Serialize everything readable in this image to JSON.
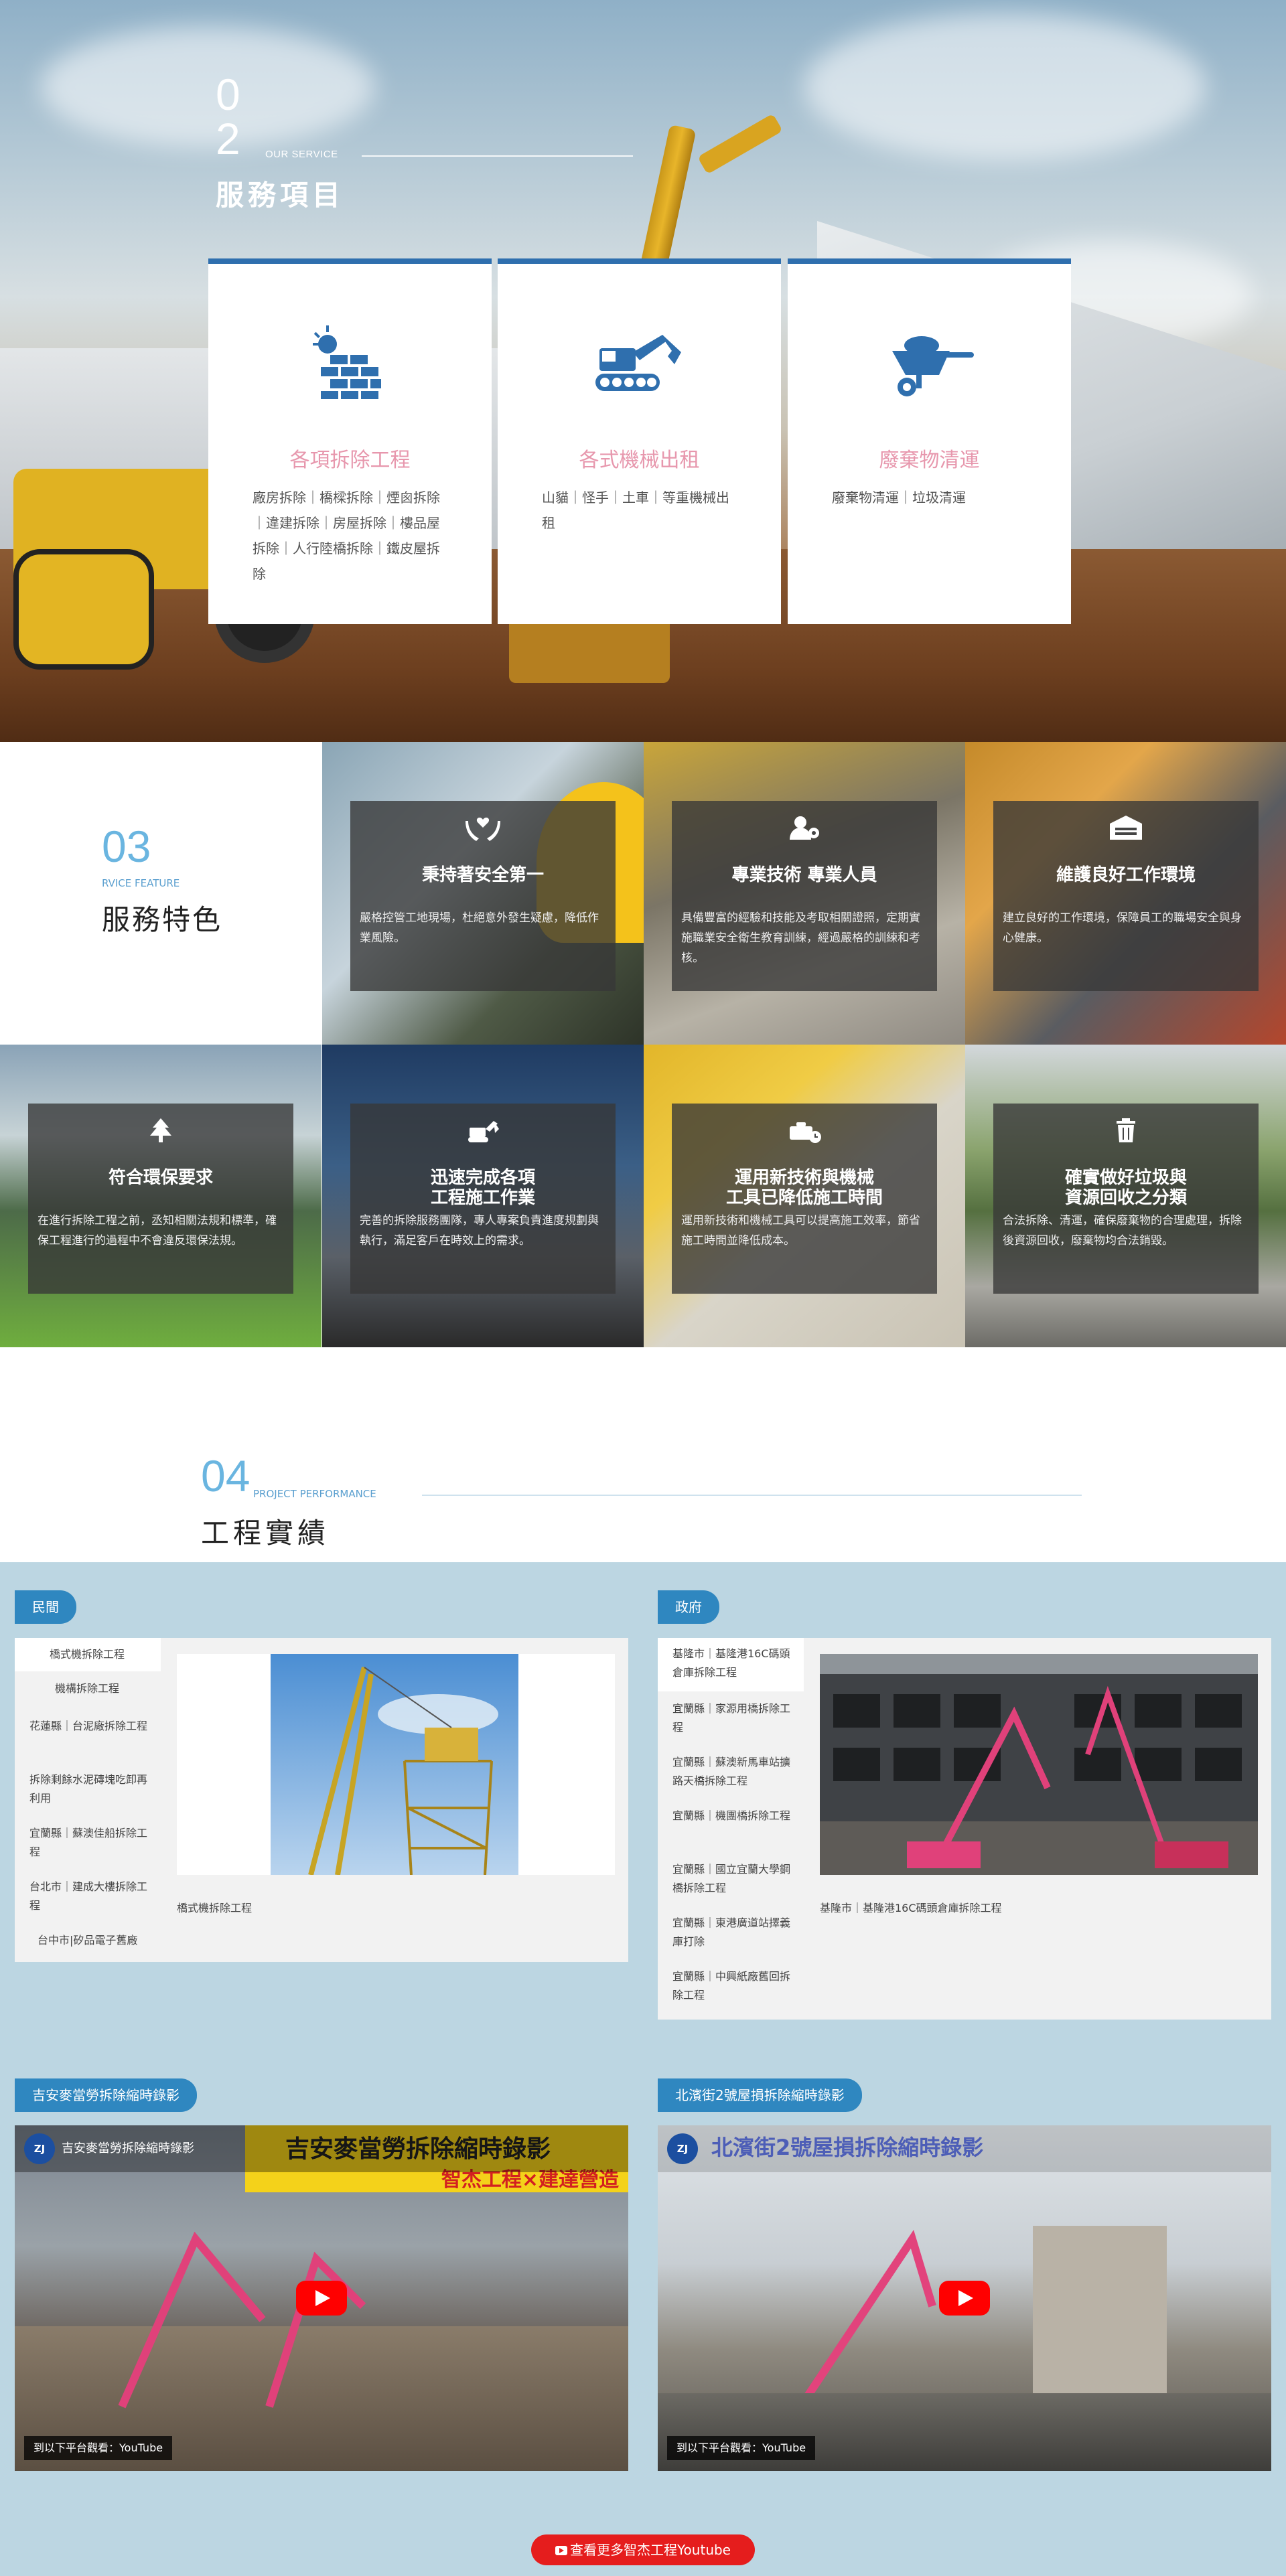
{
  "services": {
    "num_top": "0",
    "num_bottom": "2",
    "en": "OUR SERVICE",
    "zh": "服務項目",
    "cards": [
      {
        "title": "各項拆除工程",
        "desc": "廠房拆除｜橋樑拆除｜煙囪拆除｜違建拆除｜房屋拆除｜樓品屋拆除｜人行陸橋拆除｜鐵皮屋拆除",
        "icon": "brick-wall-icon"
      },
      {
        "title": "各式機械出租",
        "desc": "山貓｜怪手｜土車｜等重機械出租",
        "icon": "excavator-icon"
      },
      {
        "title": "廢棄物清運",
        "desc": "廢棄物清運｜垃圾清運",
        "icon": "wheelbarrow-icon"
      }
    ]
  },
  "features": {
    "num": "03",
    "en": "RVICE FEATURE",
    "zh": "服務特色",
    "items": [
      {
        "title": "秉持著安全第一",
        "desc": "嚴格控管工地現場，杜絕意外發生疑慮，降低作業風險。",
        "icon": "hands-heart-icon"
      },
      {
        "title": "專業技術 專業人員",
        "desc": "具備豐富的經驗和技能及考取相關證照，定期實施職業安全衛生教育訓練，經過嚴格的訓練和考核。",
        "icon": "user-gear-icon"
      },
      {
        "title": "維護良好工作環境",
        "desc": "建立良好的工作環境，保障員工的職場安全與身心健康。",
        "icon": "warehouse-icon"
      },
      {
        "title": "符合環保要求",
        "desc": "在進行拆除工程之前，丞知相關法規和標準，確保工程進行的過程中不會違反環保法規。",
        "icon": "tree-icon"
      },
      {
        "title": "迅速完成各項\n工程施工作業",
        "desc": "完善的拆除服務團隊，專人專案負責進度規劃與執行，滿足客戶在時效上的需求。",
        "icon": "digger-icon"
      },
      {
        "title": "運用新技術與機械\n工具已降低施工時間",
        "desc": "運用新技術和機械工具可以提高施工效率，節省施工時間並降低成本。",
        "icon": "toolbox-clock-icon"
      },
      {
        "title": "確實做好垃圾與\n資源回收之分類",
        "desc": "合法拆除、清運，確保廢棄物的合理處理，拆除後資源回收，廢棄物均合法銷毀。",
        "icon": "trash-icon"
      }
    ]
  },
  "performance": {
    "num": "04",
    "en": "PROJECT PERFORMANCE",
    "zh": "工程實績",
    "private": {
      "tag": "民間",
      "categories": [
        "橋式機拆除工程",
        "機構拆除工程",
        "花蓮縣｜台泥廠拆除工程",
        "拆除剩餘水泥磚塊吃卸再利用",
        "宜蘭縣｜蘇澳佳船拆除工程",
        "台北市｜建成大樓拆除工程",
        "台中市|矽品電子舊廠"
      ],
      "caption": "橋式機拆除工程"
    },
    "gov": {
      "tag": "政府",
      "categories": [
        "基隆市｜基隆港16C碼頭倉庫拆除工程",
        "宜蘭縣｜家源用橋拆除工程",
        "宜蘭縣｜蘇澳新馬車站擴路天橋拆除工程",
        "宜蘭縣｜機團橋拆除工程",
        "宜蘭縣｜國立宜蘭大學鋼橋拆除工程",
        "宜蘭縣｜東港廣道站擇義庫打除",
        "宜蘭縣｜中興紙廠舊回拆除工程"
      ],
      "caption": "基隆市｜基隆港16C碼頭倉庫拆除工程"
    },
    "videos": [
      {
        "tag": "吉安麥當勞拆除縮時錄影",
        "title": "吉安麥當勞拆除縮時錄影",
        "banner": "吉安麥當勞拆除縮時錄影",
        "sub": "智杰工程×建達營造",
        "channel": "ZJ",
        "watch": "到以下平台觀看：YouTube"
      },
      {
        "tag": "北濱街2號屋損拆除縮時錄影",
        "title": "北濱街2號屋損拆除縮時錄影",
        "banner": "北濱街2號屋損拆除縮時錄影",
        "sub": "",
        "channel": "ZJ",
        "watch": "到以下平台觀看：YouTube"
      }
    ],
    "youtube_button": "查看更多智杰工程Youtube"
  }
}
